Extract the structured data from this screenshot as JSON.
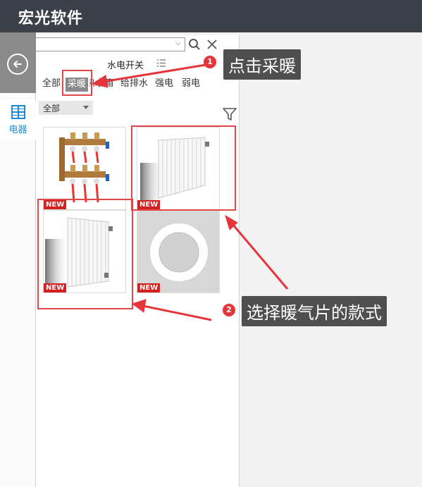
{
  "app": {
    "title": "宏光软件"
  },
  "rail": {
    "back_icon": "back-arrow-icon",
    "items": [
      {
        "label": "电器",
        "icon": "grid-icon"
      }
    ]
  },
  "search": {
    "value": "",
    "placeholder": "",
    "dropdown_glyph": "⌵"
  },
  "category": {
    "title": "水电开关"
  },
  "tabs": [
    {
      "label": "全部"
    },
    {
      "label": "采暖",
      "active": true
    },
    {
      "label": "热水箱"
    },
    {
      "label": "给排水"
    },
    {
      "label": "强电"
    },
    {
      "label": "弱电"
    }
  ],
  "filter": {
    "selected": "全部"
  },
  "products": [
    {
      "badge": "NEW",
      "kind": "manifold-valves"
    },
    {
      "badge": "NEW",
      "kind": "panel-radiator"
    },
    {
      "badge": "NEW",
      "kind": "panel-radiator"
    },
    {
      "badge": "NEW",
      "kind": "round-ring"
    }
  ],
  "annotations": [
    {
      "number": "1",
      "text": "点击采暖"
    },
    {
      "number": "2",
      "text": "选择暖气片的款式"
    }
  ],
  "colors": {
    "titlebar": "#3c4149",
    "accent_blue": "#1e8ad6",
    "annotation_red": "#e5343a",
    "new_badge": "#d32020"
  }
}
